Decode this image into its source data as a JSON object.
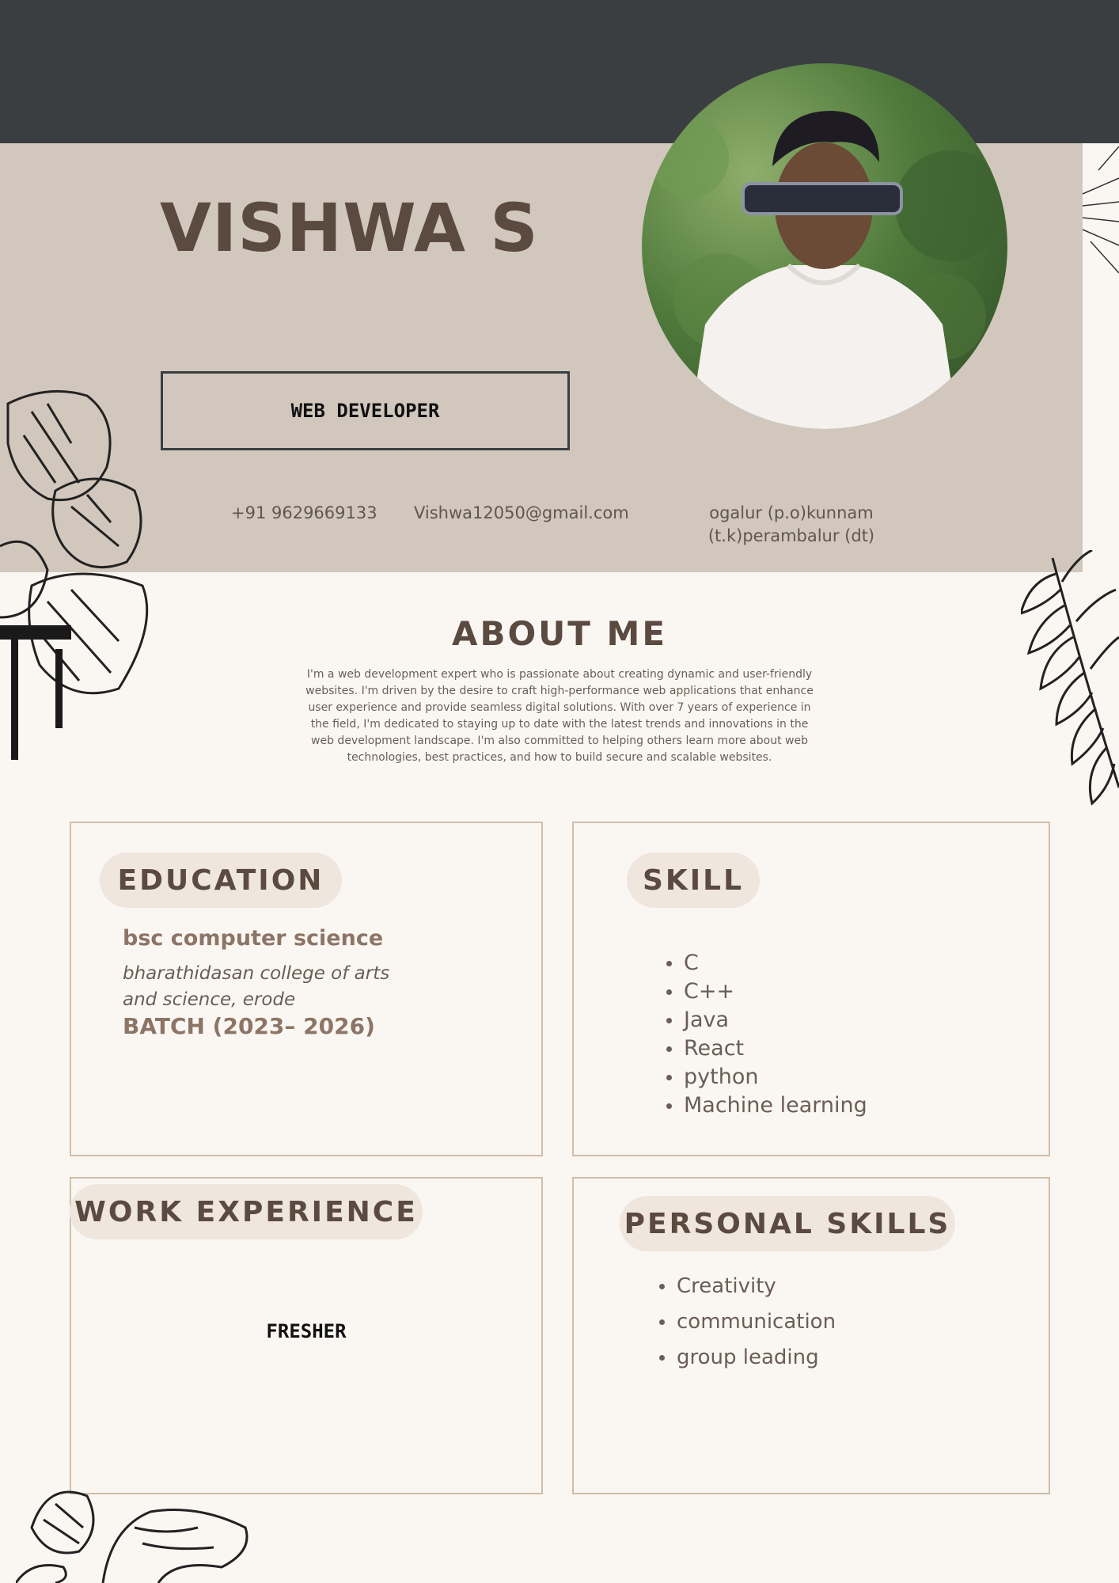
{
  "header": {
    "name": "VISHWA S",
    "role": "WEB DEVELOPER",
    "phone": "+91 9629669133",
    "email": "Vishwa12050@gmail.com",
    "address": "ogalur (p.o)kunnam (t.k)perambalur (dt)"
  },
  "about": {
    "title": "ABOUT ME",
    "text": "I'm a web development expert who is passionate about creating dynamic and user-friendly websites. I'm driven by the desire to craft high-performance web applications that enhance user experience and provide seamless digital solutions. With over 7 years of experience in the field, I'm dedicated to staying up to date with the latest trends and innovations in the web development landscape. I'm also committed to helping others learn more about web technologies, best practices, and how to build secure and scalable websites."
  },
  "education": {
    "title": "EDUCATION",
    "degree": "bsc computer science",
    "college": "bharathidasan college of arts and science, erode",
    "batch": "BATCH (2023– 2026)"
  },
  "skills": {
    "title": "SKILL",
    "items": [
      "C",
      "C++",
      "Java",
      "React",
      "python",
      "Machine learning"
    ]
  },
  "work": {
    "title": "WORK EXPERIENCE",
    "status": "FRESHER"
  },
  "personal_skills": {
    "title": "PERSONAL SKILLS",
    "items": [
      "Creativity",
      "communication",
      "group leading"
    ]
  },
  "colors": {
    "dark_band": "#3a3e41",
    "header_bg": "#d1c7bc",
    "page_bg": "#faf7f3",
    "accent_text": "#5b4a40",
    "card_border": "#d2bda6"
  }
}
